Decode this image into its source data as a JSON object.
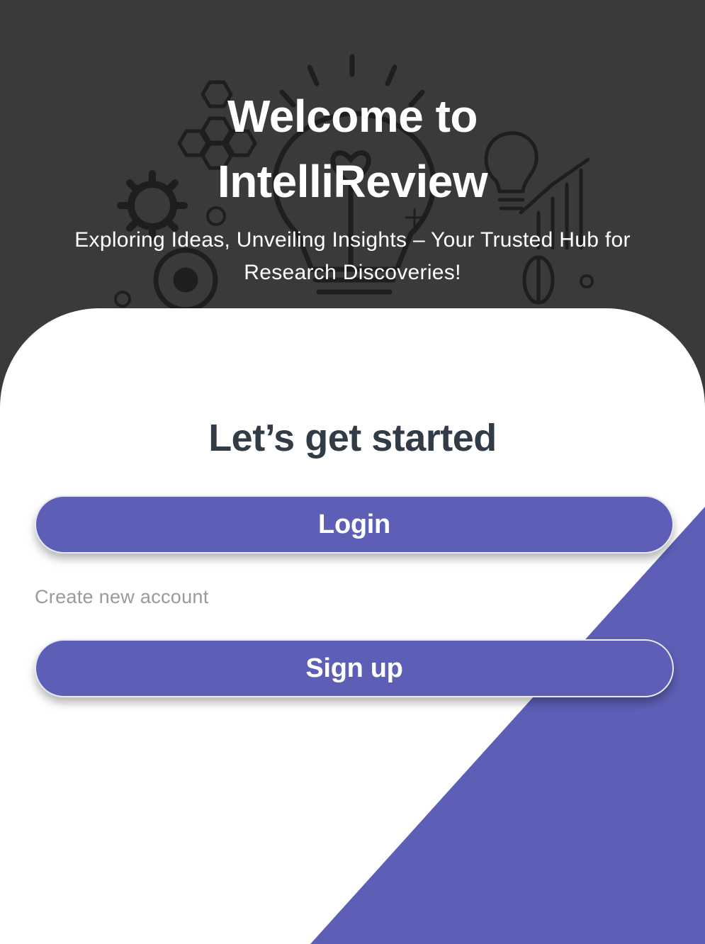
{
  "hero": {
    "title_line1": "Welcome to",
    "title_line2": "IntelliReview",
    "subtitle": "Exploring Ideas, Unveiling Insights – Your Trusted Hub for Research Discoveries!"
  },
  "card": {
    "heading": "Let’s get started",
    "login_label": "Login",
    "create_account_text": "Create new account",
    "signup_label": "Sign up"
  },
  "colors": {
    "primary": "#5c5fb5",
    "hero_background": "#3a3a38",
    "heading_text": "#323c47",
    "muted_text": "#9a9a9a"
  },
  "icons": [
    "lightbulb-icon",
    "gear-icon",
    "hexagon-icon",
    "target-icon",
    "chart-icon",
    "leaf-icon",
    "sparkle-icon"
  ]
}
